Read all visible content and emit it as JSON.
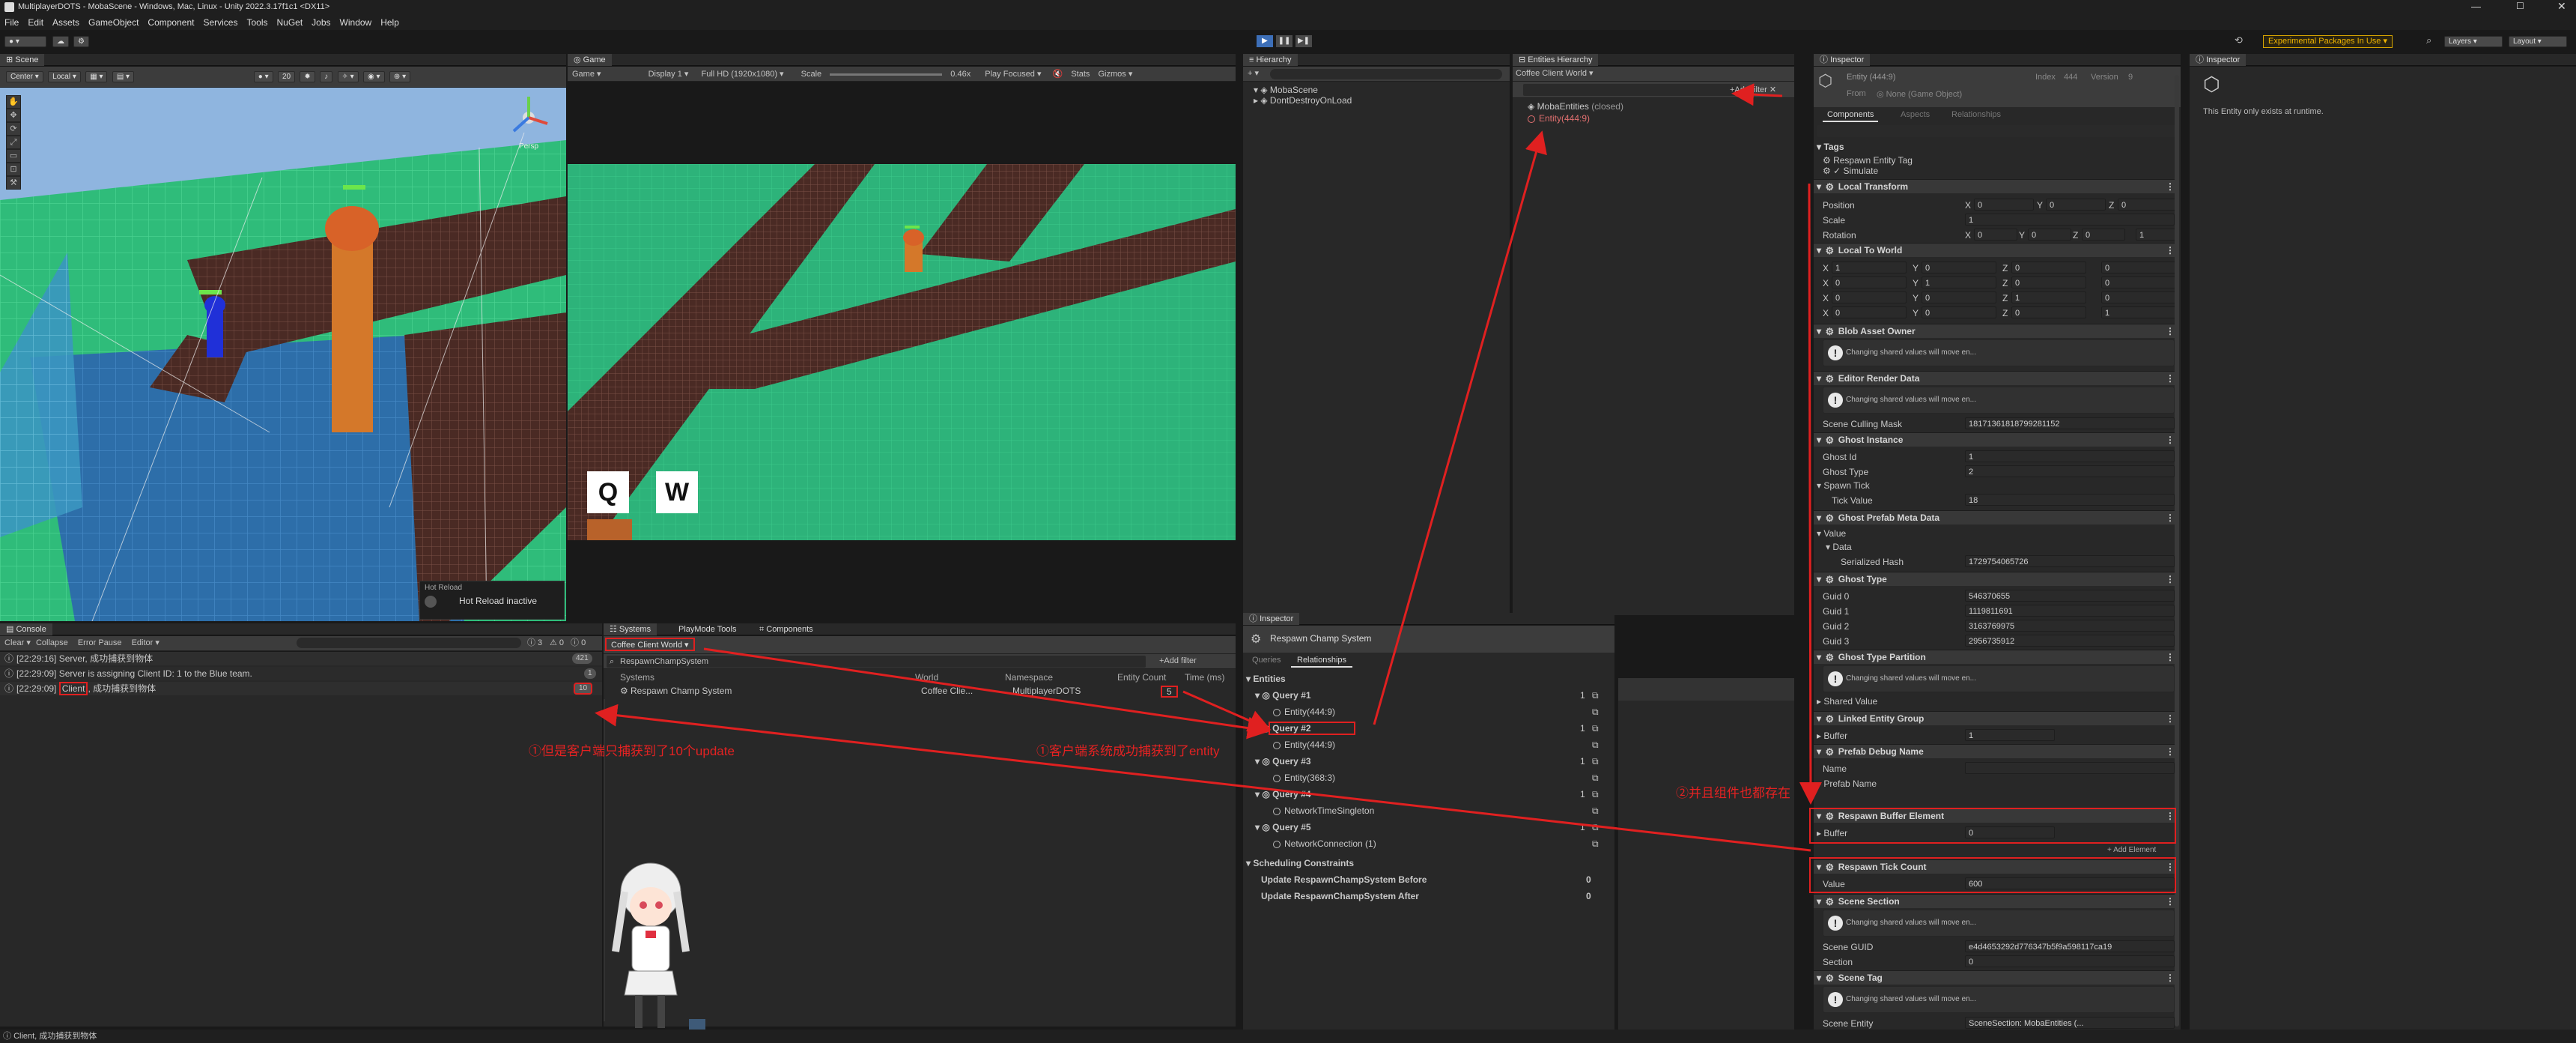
{
  "window": {
    "title": "MultiplayerDOTS - MobaScene - Windows, Mac, Linux - Unity 2022.3.17f1c1 <DX11>"
  },
  "menu": [
    "File",
    "Edit",
    "Assets",
    "GameObject",
    "Component",
    "Services",
    "Tools",
    "NuGet",
    "Jobs",
    "Window",
    "Help"
  ],
  "toolbar": {
    "experimental": "Experimental Packages In Use ▾",
    "layers": "Layers",
    "layout": "Layout"
  },
  "scene": {
    "tab": "Scene",
    "center": "Center",
    "local": "Local",
    "zoom": "20",
    "persp": "Persp",
    "hot_reload_title": "Hot Reload",
    "hot_reload_status": "Hot Reload inactive"
  },
  "game": {
    "tab": "Game",
    "mode": "Game",
    "display": "Display 1",
    "resolution": "Full HD (1920x1080)",
    "scale_label": "Scale",
    "scale_value": "0.46x",
    "play_focused": "Play Focused",
    "stats": "Stats",
    "gizmos": "Gizmos",
    "key_q": "Q",
    "key_w": "W"
  },
  "hierarchy": {
    "tab": "Hierarchy",
    "items": [
      "MobaScene",
      "DontDestroyOnLoad"
    ]
  },
  "entities_hierarchy": {
    "tab": "Entities Hierarchy",
    "world": "Coffee Client World ▾",
    "items": [
      {
        "label": "MobaEntities",
        "suffix": "(closed)"
      },
      {
        "label": "Entity(444:9)"
      }
    ]
  },
  "console": {
    "tab": "Console",
    "clear": "Clear",
    "collapse": "Collapse",
    "error_pause": "Error Pause",
    "editor": "Editor ▾",
    "count_warn": "0",
    "count_err": "0",
    "messages": [
      {
        "time": "[22:29:16]",
        "text": "Server, 成功捕获到物体",
        "count": "421"
      },
      {
        "time": "[22:29:09]",
        "text": "Server is assigning Client ID: 1 to the Blue team.",
        "count": "1"
      },
      {
        "time": "[22:29:09]",
        "pre": "",
        "highlight": "Client",
        "text": ", 成功捕获到物体",
        "count": "10"
      }
    ]
  },
  "systems": {
    "tabs": [
      "Systems",
      "PlayMode Tools",
      "Components"
    ],
    "world": "Coffee Client World ▾",
    "search": "RespawnChampSystem",
    "add_filter": "+Add filter",
    "columns": [
      "Systems",
      "World",
      "Namespace",
      "Entity Count",
      "Time (ms)"
    ],
    "rows": [
      {
        "name": "Respawn Champ System",
        "world": "Coffee Clie...",
        "namespace": "MultiplayerDOTS",
        "entity_count": "5",
        "time": ""
      }
    ]
  },
  "inspector_sys": {
    "tab": "Inspector",
    "title": "Respawn Champ System",
    "subtabs": [
      "Queries",
      "Relationships"
    ],
    "entities_header": "Entities",
    "queries": [
      {
        "name": "Query #1",
        "count": "1",
        "items": [
          "Entity(444:9)"
        ]
      },
      {
        "name": "Query #2",
        "count": "1",
        "items": [
          "Entity(444:9)"
        ]
      },
      {
        "name": "Query #3",
        "count": "1",
        "items": [
          "Entity(368:3)"
        ]
      },
      {
        "name": "Query #4",
        "count": "1",
        "items": [
          "NetworkTimeSingleton"
        ]
      },
      {
        "name": "Query #5",
        "count": "1",
        "items": [
          "NetworkConnection (1)"
        ]
      }
    ],
    "sched_header": "Scheduling Constraints",
    "sched": [
      {
        "label": "Update RespawnChampSystem Before",
        "count": "0"
      },
      {
        "label": "Update RespawnChampSystem After",
        "count": "0"
      }
    ]
  },
  "inspector": {
    "tab": "Inspector",
    "entity": "Entity (444:9)",
    "index_label": "Index",
    "index": "444",
    "version_label": "Version",
    "version": "9",
    "from_label": "From",
    "from_value": "None (Game Object)",
    "subtabs": [
      "Components",
      "Aspects",
      "Relationships"
    ],
    "tags_header": "Tags",
    "tags": [
      "Respawn Entity Tag",
      "Simulate"
    ],
    "local_transform": {
      "header": "Local Transform",
      "position": "Position",
      "scale": "Scale",
      "rotation": "Rotation",
      "pos": [
        "0",
        "0",
        "0"
      ],
      "scale_v": "1",
      "rot": [
        "0",
        "0",
        "0",
        "1"
      ]
    },
    "local_to_world": {
      "header": "Local To World",
      "rows": [
        [
          "1",
          "0",
          "0",
          "0"
        ],
        [
          "0",
          "1",
          "0",
          "0"
        ],
        [
          "0",
          "0",
          "1",
          "0"
        ],
        [
          "0",
          "0",
          "0",
          "1"
        ]
      ]
    },
    "blob_asset_owner": "Blob Asset Owner",
    "shared_warn": "Changing shared values will move en...",
    "editor_render_data": "Editor Render Data",
    "scene_culling_label": "Scene Culling Mask",
    "scene_culling": "18171361818799281152",
    "ghost_instance": {
      "header": "Ghost Instance",
      "ghost_id": "Ghost Id",
      "ghost_id_v": "1",
      "ghost_type": "Ghost Type",
      "ghost_type_v": "2",
      "spawn_tick": "Spawn Tick",
      "tick_value": "Tick Value",
      "tick_value_v": "18"
    },
    "ghost_prefab_meta": {
      "header": "Ghost Prefab Meta Data",
      "value": "Value",
      "data": "Data",
      "serialized_hash": "Serialized Hash",
      "serialized_hash_v": "1729754065726"
    },
    "ghost_type": {
      "header": "Ghost Type",
      "guids": [
        [
          "Guid 0",
          "546370655"
        ],
        [
          "Guid 1",
          "1119811691"
        ],
        [
          "Guid 2",
          "3163769975"
        ],
        [
          "Guid 3",
          "2956735912"
        ]
      ]
    },
    "ghost_type_partition": "Ghost Type Partition",
    "shared_value": "Shared Value",
    "linked_entity_group": {
      "header": "Linked Entity Group",
      "buffer": "Buffer",
      "buffer_v": "1"
    },
    "prefab_debug_name": {
      "header": "Prefab Debug Name",
      "name": "Name",
      "prefab_name": "Prefab Name"
    },
    "respawn_buffer": {
      "header": "Respawn Buffer Element",
      "buffer": "Buffer",
      "buffer_v": "0"
    },
    "add_element": "+ Add Element",
    "respawn_tick": {
      "header": "Respawn Tick Count",
      "value": "Value",
      "value_v": "600"
    },
    "scene_section": {
      "header": "Scene Section",
      "scene_guid": "Scene GUID",
      "scene_guid_v": "e4d4653292d776347b5f9a598117ca19",
      "section": "Section",
      "section_v": "0"
    },
    "scene_tag": {
      "header": "Scene Tag",
      "scene_entity": "Scene Entity",
      "scene_entity_v": "SceneSection: MobaEntities (..."
    }
  },
  "inspector2": {
    "tab": "Inspector",
    "runtime": "This Entity only exists at runtime."
  },
  "annotations": {
    "a1": "①但是客户端只捕获到了10个update",
    "a2": "①客户端系统成功捕获到了entity",
    "a3": "②并且组件也都存在"
  },
  "status_bar": "Client, 成功捕获到物体"
}
